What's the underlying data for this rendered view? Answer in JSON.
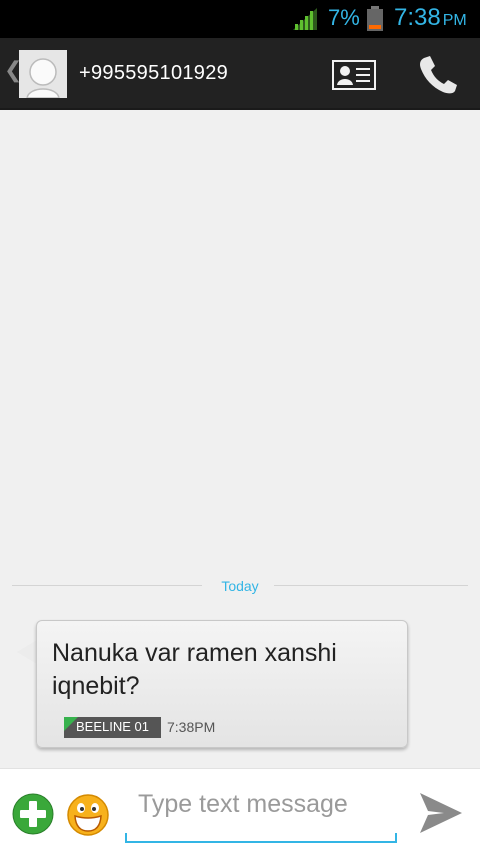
{
  "status_bar": {
    "battery_percent": "7%",
    "time": "7:38",
    "ampm": "PM",
    "accent_color": "#33b5e5"
  },
  "action_bar": {
    "contact_number": "+995595101929",
    "icons": [
      "back-chevron-icon",
      "contact-avatar-icon",
      "contact-card-icon",
      "phone-call-icon"
    ]
  },
  "conversation": {
    "date_label": "Today",
    "messages": [
      {
        "text": "Nanuka var ramen xanshi iqnebit?",
        "sim": "BEELINE 01",
        "time": "7:38PM",
        "direction": "incoming"
      }
    ]
  },
  "compose": {
    "placeholder": "Type text message",
    "icons": [
      "add-attachment-icon",
      "emoji-icon",
      "send-icon"
    ]
  }
}
